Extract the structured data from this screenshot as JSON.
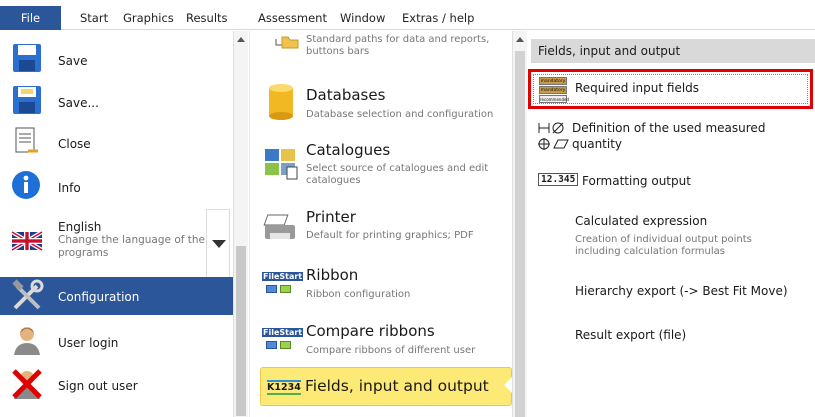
{
  "menu": {
    "file": "File",
    "items": [
      "Start",
      "Graphics",
      "Results",
      "Assessment",
      "Window",
      "Extras / help"
    ]
  },
  "left": {
    "save": "Save",
    "save_as": "Save...",
    "close": "Close",
    "info": "Info",
    "language": "English",
    "language_sub": "Change the language of the programs",
    "configuration": "Configuration",
    "user_login": "User login",
    "sign_out": "Sign out user"
  },
  "middle": {
    "paths_sub": "Standard paths for data and reports, buttons bars",
    "databases": "Databases",
    "databases_sub": "Database selection and configuration",
    "catalogues": "Catalogues",
    "catalogues_sub": "Select source of catalogues and edit catalogues",
    "printer": "Printer",
    "printer_sub": "Default for printing graphics; PDF",
    "ribbon": "Ribbon",
    "ribbon_sub": "Ribbon configuration",
    "compare_ribbons": "Compare ribbons",
    "compare_ribbons_sub": "Compare ribbons of different user",
    "fields": "Fields, input and output",
    "fields_icon_text": "K1234"
  },
  "right": {
    "header": "Fields, input and output",
    "required_fields": "Required input fields",
    "required_badges": [
      "mandatory",
      "mandatory",
      "recommended"
    ],
    "definition_line1": "Definition of the used measured",
    "definition_line2": "quantity",
    "formatting_badge": "12.345",
    "formatting": "Formatting output",
    "calculated": "Calculated expression",
    "calculated_sub": "Creation of individual output points including calculation formulas",
    "hierarchy": "Hierarchy export (-> Best Fit Move)",
    "result_export": "Result export (file)"
  },
  "icons": {
    "file_start": "FileStart"
  },
  "colors": {
    "accent": "#2b579a",
    "highlight": "#fde975",
    "frame": "#e00000"
  }
}
